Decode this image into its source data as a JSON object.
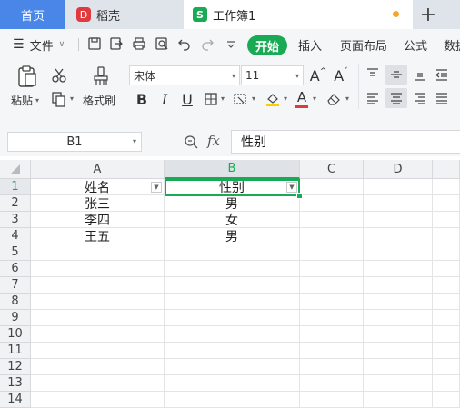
{
  "tabs": {
    "home": "首页",
    "daoke": "稻壳",
    "workbook": "工作簿1",
    "daoke_logo": "D",
    "workbook_logo": "S"
  },
  "menu": {
    "file": "文件",
    "items": [
      "开始",
      "插入",
      "页面布局",
      "公式",
      "数据"
    ]
  },
  "ribbon": {
    "paste": "粘贴",
    "format_painter": "格式刷",
    "font_name": "宋体",
    "font_size": "11",
    "font_bigger": "A",
    "font_smaller": "A",
    "bold": "B",
    "italic": "I",
    "underline": "U",
    "font_color_glyph": "A"
  },
  "formula": {
    "name_box": "B1",
    "fx": "fx",
    "content": "性别"
  },
  "sheet": {
    "columns": [
      "A",
      "B",
      "C",
      "D"
    ],
    "active_column": "B",
    "active_row": 1,
    "rows": [
      "1",
      "2",
      "3",
      "4",
      "5",
      "6",
      "7",
      "8",
      "9",
      "10",
      "11",
      "12",
      "13",
      "14"
    ],
    "data": [
      [
        "姓名",
        "性别"
      ],
      [
        "张三",
        "男"
      ],
      [
        "李四",
        "女"
      ],
      [
        "王五",
        "男"
      ]
    ]
  },
  "colors": {
    "accent_green": "#1aaa55",
    "home_tab_blue": "#4a86e8",
    "unsaved_dot": "#f5a623"
  }
}
